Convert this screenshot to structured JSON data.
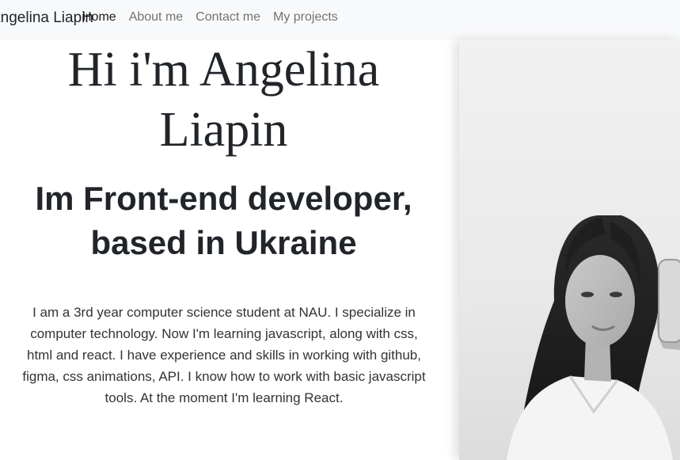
{
  "nav": {
    "brand": "Angelina Liapin",
    "links": [
      {
        "label": "Home",
        "active": true
      },
      {
        "label": "About me",
        "active": false
      },
      {
        "label": "Contact me",
        "active": false
      },
      {
        "label": "My projects",
        "active": false
      }
    ]
  },
  "hero": {
    "greeting": "Hi i'm Angelina Liapin",
    "subtitle": "Im Front-end developer, based in Ukraine",
    "bio": "I am a 3rd year computer science student at NAU. I specialize in computer technology. Now I'm learning javascript, along with css, html and react. I have experience and skills in working with github, figma, css animations, API. I know how to work with basic javascript tools. At the moment I'm learning React."
  },
  "photo": {
    "icon": "portrait-photo"
  }
}
